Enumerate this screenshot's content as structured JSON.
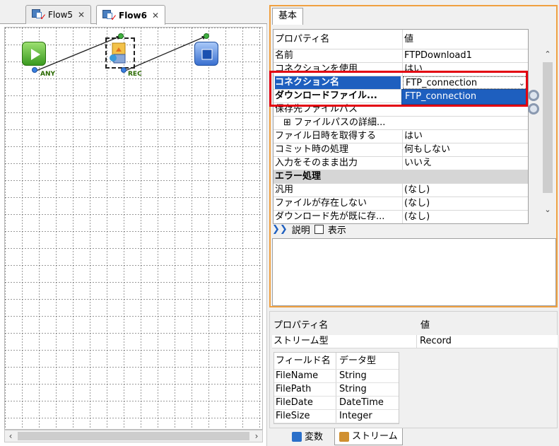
{
  "editor": {
    "tabs": [
      {
        "label": "Flow5",
        "active": false
      },
      {
        "label": "Flow6",
        "active": true
      }
    ],
    "nodes": {
      "start_label": "ANY",
      "download_label": "REC"
    }
  },
  "properties": {
    "tab_label": "基本",
    "header_name": "プロパティ名",
    "header_value": "値",
    "rows": [
      {
        "key": "名前",
        "value": "FTPDownload1"
      },
      {
        "key": "コネクションを使用",
        "value": "はい"
      },
      {
        "key": "コネクション名",
        "value": "FTP_connection"
      },
      {
        "key": "ダウンロードファイル...",
        "value": ""
      },
      {
        "key": "保存先ファイルパス",
        "value": ""
      },
      {
        "key": "⊞ ファイルパスの詳細...",
        "value": ""
      },
      {
        "key": "ファイル日時を取得する",
        "value": "はい"
      },
      {
        "key": "コミット時の処理",
        "value": "何もしない"
      },
      {
        "key": "入力をそのまま出力",
        "value": "いいえ"
      },
      {
        "key": "エラー処理",
        "value": ""
      },
      {
        "key": "汎用",
        "value": "(なし)"
      },
      {
        "key": "ファイルが存在しない",
        "value": "(なし)"
      },
      {
        "key": "ダウンロード先が既に存...",
        "value": "(なし)"
      }
    ],
    "dropdown_option": "FTP_connection",
    "description_label": "説明",
    "show_label": "表示"
  },
  "stream": {
    "header_name": "プロパティ名",
    "header_value": "値",
    "type_key": "ストリーム型",
    "type_value": "Record",
    "field_header": "フィールド名",
    "type_header": "データ型",
    "fields": [
      {
        "name": "FileName",
        "type": "String"
      },
      {
        "name": "FilePath",
        "type": "String"
      },
      {
        "name": "FileDate",
        "type": "DateTime"
      },
      {
        "name": "FileSize",
        "type": "Integer"
      }
    ],
    "bottom_tabs": [
      "変数",
      "ストリーム"
    ]
  },
  "colors": {
    "accent": "#1e5fbf",
    "highlight_border": "#e3000f",
    "panel_border": "#f0a040"
  }
}
